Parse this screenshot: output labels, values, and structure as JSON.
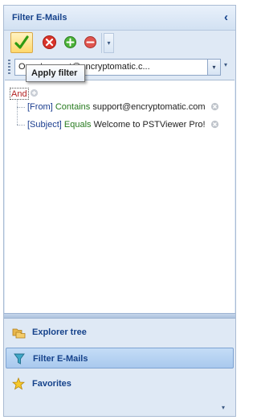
{
  "panel": {
    "title": "Filter E-Mails",
    "collapse_glyph": "‹"
  },
  "toolbar": {
    "apply_icon": "checkmark-icon",
    "cancel_icon": "cancel-x-icon",
    "add_icon": "add-plus-icon",
    "remove_icon": "remove-minus-icon",
    "more_glyph": "▾"
  },
  "tooltip": {
    "text": "Apply filter"
  },
  "filter_combo": {
    "value": "Or ... 'support@encryptomatic.c...",
    "arrow_glyph": "▾"
  },
  "filter_tree": {
    "root_label": "And",
    "conditions": [
      {
        "field": "[From]",
        "operator": "Contains",
        "value": "support@encryptomatic.com"
      },
      {
        "field": "[Subject]",
        "operator": "Equals",
        "value": "Welcome to PSTViewer Pro!"
      }
    ]
  },
  "nav": {
    "items": [
      {
        "label": "Explorer tree",
        "icon": "folders-icon",
        "selected": false
      },
      {
        "label": "Filter E-Mails",
        "icon": "funnel-filter-icon",
        "selected": true
      },
      {
        "label": "Favorites",
        "icon": "star-icon",
        "selected": false
      }
    ],
    "more_glyph": "▾"
  },
  "colors": {
    "accent": "#15428b",
    "operator": "#267a1e",
    "root_label": "#b22020",
    "panel_bg": "#dfe9f5"
  }
}
